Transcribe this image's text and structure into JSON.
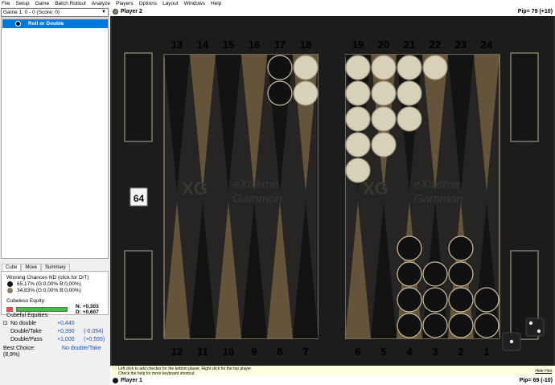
{
  "menu": [
    "File",
    "Setup",
    "Game",
    "Batch Rollout",
    "Analyze",
    "Players",
    "Options",
    "Layout",
    "Windows",
    "Help"
  ],
  "game_select": "Game 1: 0 - 0 (Score: 0)",
  "move_row": "Roll or Double",
  "tabs": [
    "Cube",
    "Move",
    "Summary"
  ],
  "analysis": {
    "header": "Winning Chances ND (click for D/T)",
    "p1_chances": "65,17% (G:0,00% B:0,00%)",
    "p2_chances": "34,83% (G:0,00% B:0,00%)",
    "cubeless_label": "Cubeless Equity:",
    "n_value": "N: +0,303",
    "d_value": "D: +0,607"
  },
  "equities": {
    "title": "Cubeful Equities:",
    "rows": [
      {
        "label": "No double",
        "v1": "+0,445",
        "v2": ""
      },
      {
        "label": "Double/Take",
        "v1": "+0,390",
        "v2": "(-0,054)"
      },
      {
        "label": "Double/Pass",
        "v1": "+1,000",
        "v2": "(+0,555)"
      }
    ],
    "best_label": "Best Choice:",
    "best_value": "No double/Take",
    "best_pct": "(8,9%)"
  },
  "player_top": "Player 2",
  "player_bottom": "Player 1",
  "pip_top": "Pip= 79 (+10)",
  "pip_bottom": "Pip= 69 (-10)",
  "cube_value": "64",
  "top_numbers": [
    "13",
    "14",
    "15",
    "16",
    "17",
    "18",
    "19",
    "20",
    "21",
    "22",
    "23",
    "24"
  ],
  "bottom_numbers": [
    "12",
    "11",
    "10",
    "9",
    "8",
    "7",
    "6",
    "5",
    "4",
    "3",
    "2",
    "1"
  ],
  "watermark": "eXtreme Gammon",
  "watermark_logo": "XG",
  "hint_line1": "Left click to add checker for the bottom player, Right click for the top player.",
  "hint_line2": "Check the help for more keyboard shortcut.",
  "hide_hint": "Hide Hint",
  "colors": {
    "selection": "#0078d7",
    "board_bg": "#1e1e1e",
    "light_checker": "#d8d0b8",
    "dark_checker": "#111111",
    "equity_bar": "#3cc43c"
  },
  "checkers": {
    "top": [
      {
        "point": 17,
        "color": "dark",
        "count": 2
      },
      {
        "point": 18,
        "color": "light",
        "count": 2
      },
      {
        "point": 19,
        "color": "light",
        "count": 5
      },
      {
        "point": 20,
        "color": "light",
        "count": 4
      },
      {
        "point": 21,
        "color": "light",
        "count": 3
      },
      {
        "point": 22,
        "color": "light",
        "count": 1
      }
    ],
    "bottom": [
      {
        "point": 4,
        "color": "dark",
        "count": 4
      },
      {
        "point": 3,
        "color": "dark",
        "count": 3
      },
      {
        "point": 2,
        "color": "dark",
        "count": 4
      },
      {
        "point": 1,
        "color": "dark",
        "count": 2
      }
    ]
  },
  "dice": [
    1,
    2
  ]
}
